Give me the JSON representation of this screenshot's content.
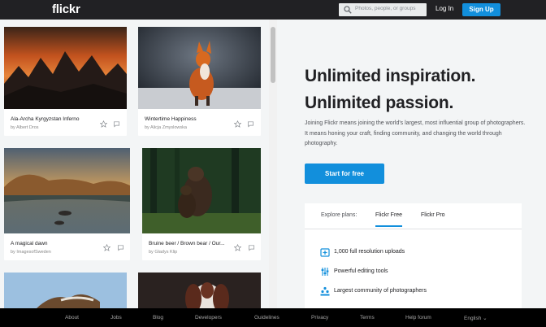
{
  "header": {
    "logo": "flickr",
    "search_placeholder": "Photos, people, or groups",
    "login": "Log In",
    "signup": "Sign Up"
  },
  "photos": [
    {
      "title": "Ala-Archa Kyrgyzstan Inferno",
      "author": "by Albert Dros"
    },
    {
      "title": "Wintertime Happiness",
      "author": "by Alicja Zmyslowska"
    },
    {
      "title": "A magical dawn",
      "author": "by ImagesofSweden"
    },
    {
      "title": "Bruine beer / Brown bear / Our...",
      "author": "by Gladys Klip"
    }
  ],
  "hero": {
    "line1": "Unlimited inspiration.",
    "line2": "Unlimited passion.",
    "description": "Joining Flickr means joining the world's largest, most influential group of photographers. It means honing your craft, finding community, and changing the world through photography.",
    "cta": "Start for free"
  },
  "plans": {
    "label": "Explore plans:",
    "tabs": [
      "Flickr Free",
      "Flickr Pro"
    ],
    "features": [
      {
        "icon": "upload-icon",
        "text": "1,000 full resolution uploads"
      },
      {
        "icon": "sliders-icon",
        "text": "Powerful editing tools"
      },
      {
        "icon": "community-icon",
        "text": "Largest community of photographers"
      }
    ]
  },
  "footer": {
    "links": [
      "About",
      "Jobs",
      "Blog",
      "Developers",
      "Guidelines",
      "Privacy",
      "Terms",
      "Help forum",
      "English ⌄"
    ]
  },
  "colors": {
    "topbar": "#212124",
    "accent": "#128fdc",
    "footer": "#000000",
    "background": "#f3f5f6"
  }
}
